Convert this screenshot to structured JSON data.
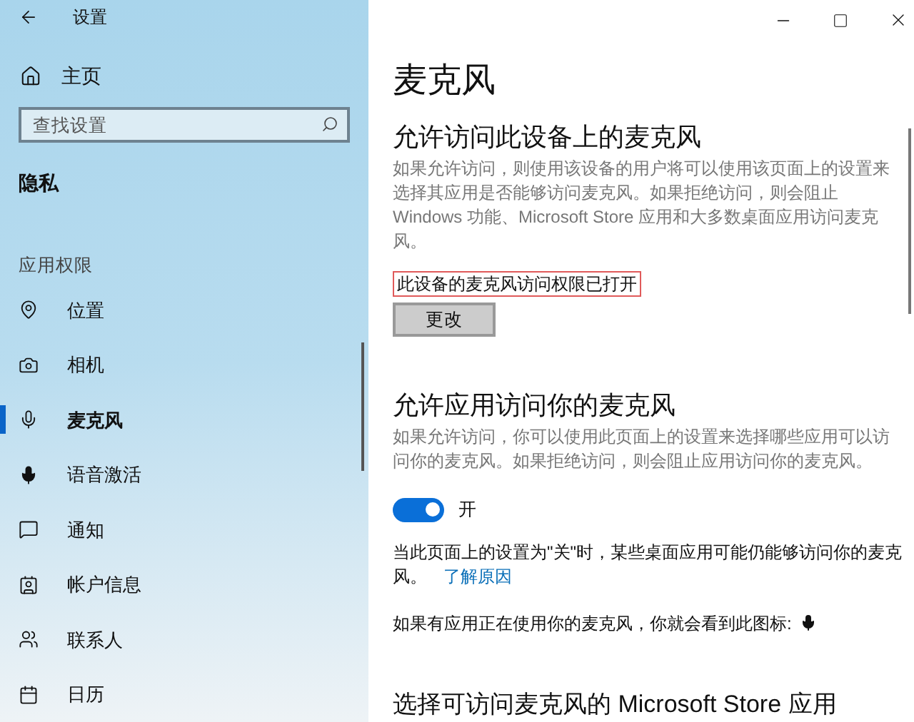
{
  "window": {
    "title": "设置"
  },
  "sidebar": {
    "home": "主页",
    "search": {
      "placeholder": "查找设置"
    },
    "section": "隐私",
    "group": "应用权限",
    "items": [
      {
        "label": "位置",
        "selected": false
      },
      {
        "label": "相机",
        "selected": false
      },
      {
        "label": "麦克风",
        "selected": true
      },
      {
        "label": "语音激活",
        "selected": false
      },
      {
        "label": "通知",
        "selected": false
      },
      {
        "label": "帐户信息",
        "selected": false
      },
      {
        "label": "联系人",
        "selected": false
      },
      {
        "label": "日历",
        "selected": false
      }
    ]
  },
  "page": {
    "title": "麦克风",
    "device_access": {
      "heading": "允许访问此设备上的麦克风",
      "description": "如果允许访问，则使用该设备的用户将可以使用该页面上的设置来选择其应用是否能够访问麦克风。如果拒绝访问，则会阻止 Windows 功能、Microsoft Store 应用和大多数桌面应用访问麦克风。",
      "status": "此设备的麦克风访问权限已打开",
      "button": "更改"
    },
    "app_access": {
      "heading": "允许应用访问你的麦克风",
      "description": "如果允许访问，你可以使用此页面上的设置来选择哪些应用可以访问你的麦克风。如果拒绝访问，则会阻止应用访问你的麦克风。",
      "toggle": {
        "on": true,
        "label": "开"
      },
      "note": "当此页面上的设置为\"关\"时，某些桌面应用可能仍能够访问你的麦克风。",
      "link": "了解原因",
      "indicator_note": "如果有应用正在使用你的麦克风，你就会看到此图标:"
    },
    "store_apps": {
      "heading": "选择可访问麦克风的 Microsoft Store 应用"
    }
  }
}
